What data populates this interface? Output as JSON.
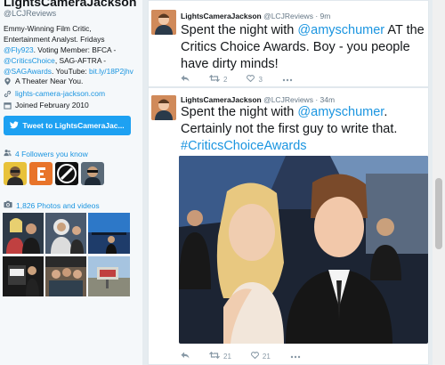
{
  "profile": {
    "display_name": "LightsCameraJackson",
    "handle": "@LCJReviews",
    "bio_1": "Emmy-Winning Film Critic, Entertainment Analyst. Fridays ",
    "bio_mention_1": "@Fly923",
    "bio_2": ". Voting Member: BFCA - ",
    "bio_mention_2": "@CriticsChoice",
    "bio_3": ", SAG-AFTRA - ",
    "bio_mention_3": "@SAGAwards",
    "bio_4": ". YouTube: ",
    "bio_link": "bit.ly/18P2jhv",
    "location": "A Theater Near You.",
    "website": "lights-camera-jackson.com",
    "joined": "Joined February 2010",
    "tweet_to_label": "Tweet to LightsCameraJac...",
    "followers_you_know": "4 Followers you know",
    "photos_videos": "1,826 Photos and videos"
  },
  "tweets": [
    {
      "name": "LightsCameraJackson",
      "handle": "@LCJReviews",
      "time": "· 9m",
      "text_1": "Spent the night with ",
      "mention": "@amyschumer",
      "text_2": " AT the Critics Choice Awards. Boy - you people have dirty minds!",
      "retweets": "2",
      "likes": "3"
    },
    {
      "name": "LightsCameraJackson",
      "handle": "@LCJReviews",
      "time": "· 34m",
      "text_1": "Spent the night with ",
      "mention": "@amyschumer",
      "text_2": ". Certainly not the first guy to write that. ",
      "hashtag": "#CriticsChoiceAwards",
      "retweets": "21",
      "likes": "21"
    }
  ],
  "colors": {
    "accent": "#1da1f2",
    "link": "#1b95e0"
  },
  "icons": {
    "location": "pin-icon",
    "website": "link-icon",
    "joined": "calendar-icon",
    "followers": "people-icon",
    "photos": "camera-icon",
    "reply": "reply-icon",
    "retweet": "retweet-icon",
    "like": "heart-icon",
    "more": "more-icon"
  }
}
